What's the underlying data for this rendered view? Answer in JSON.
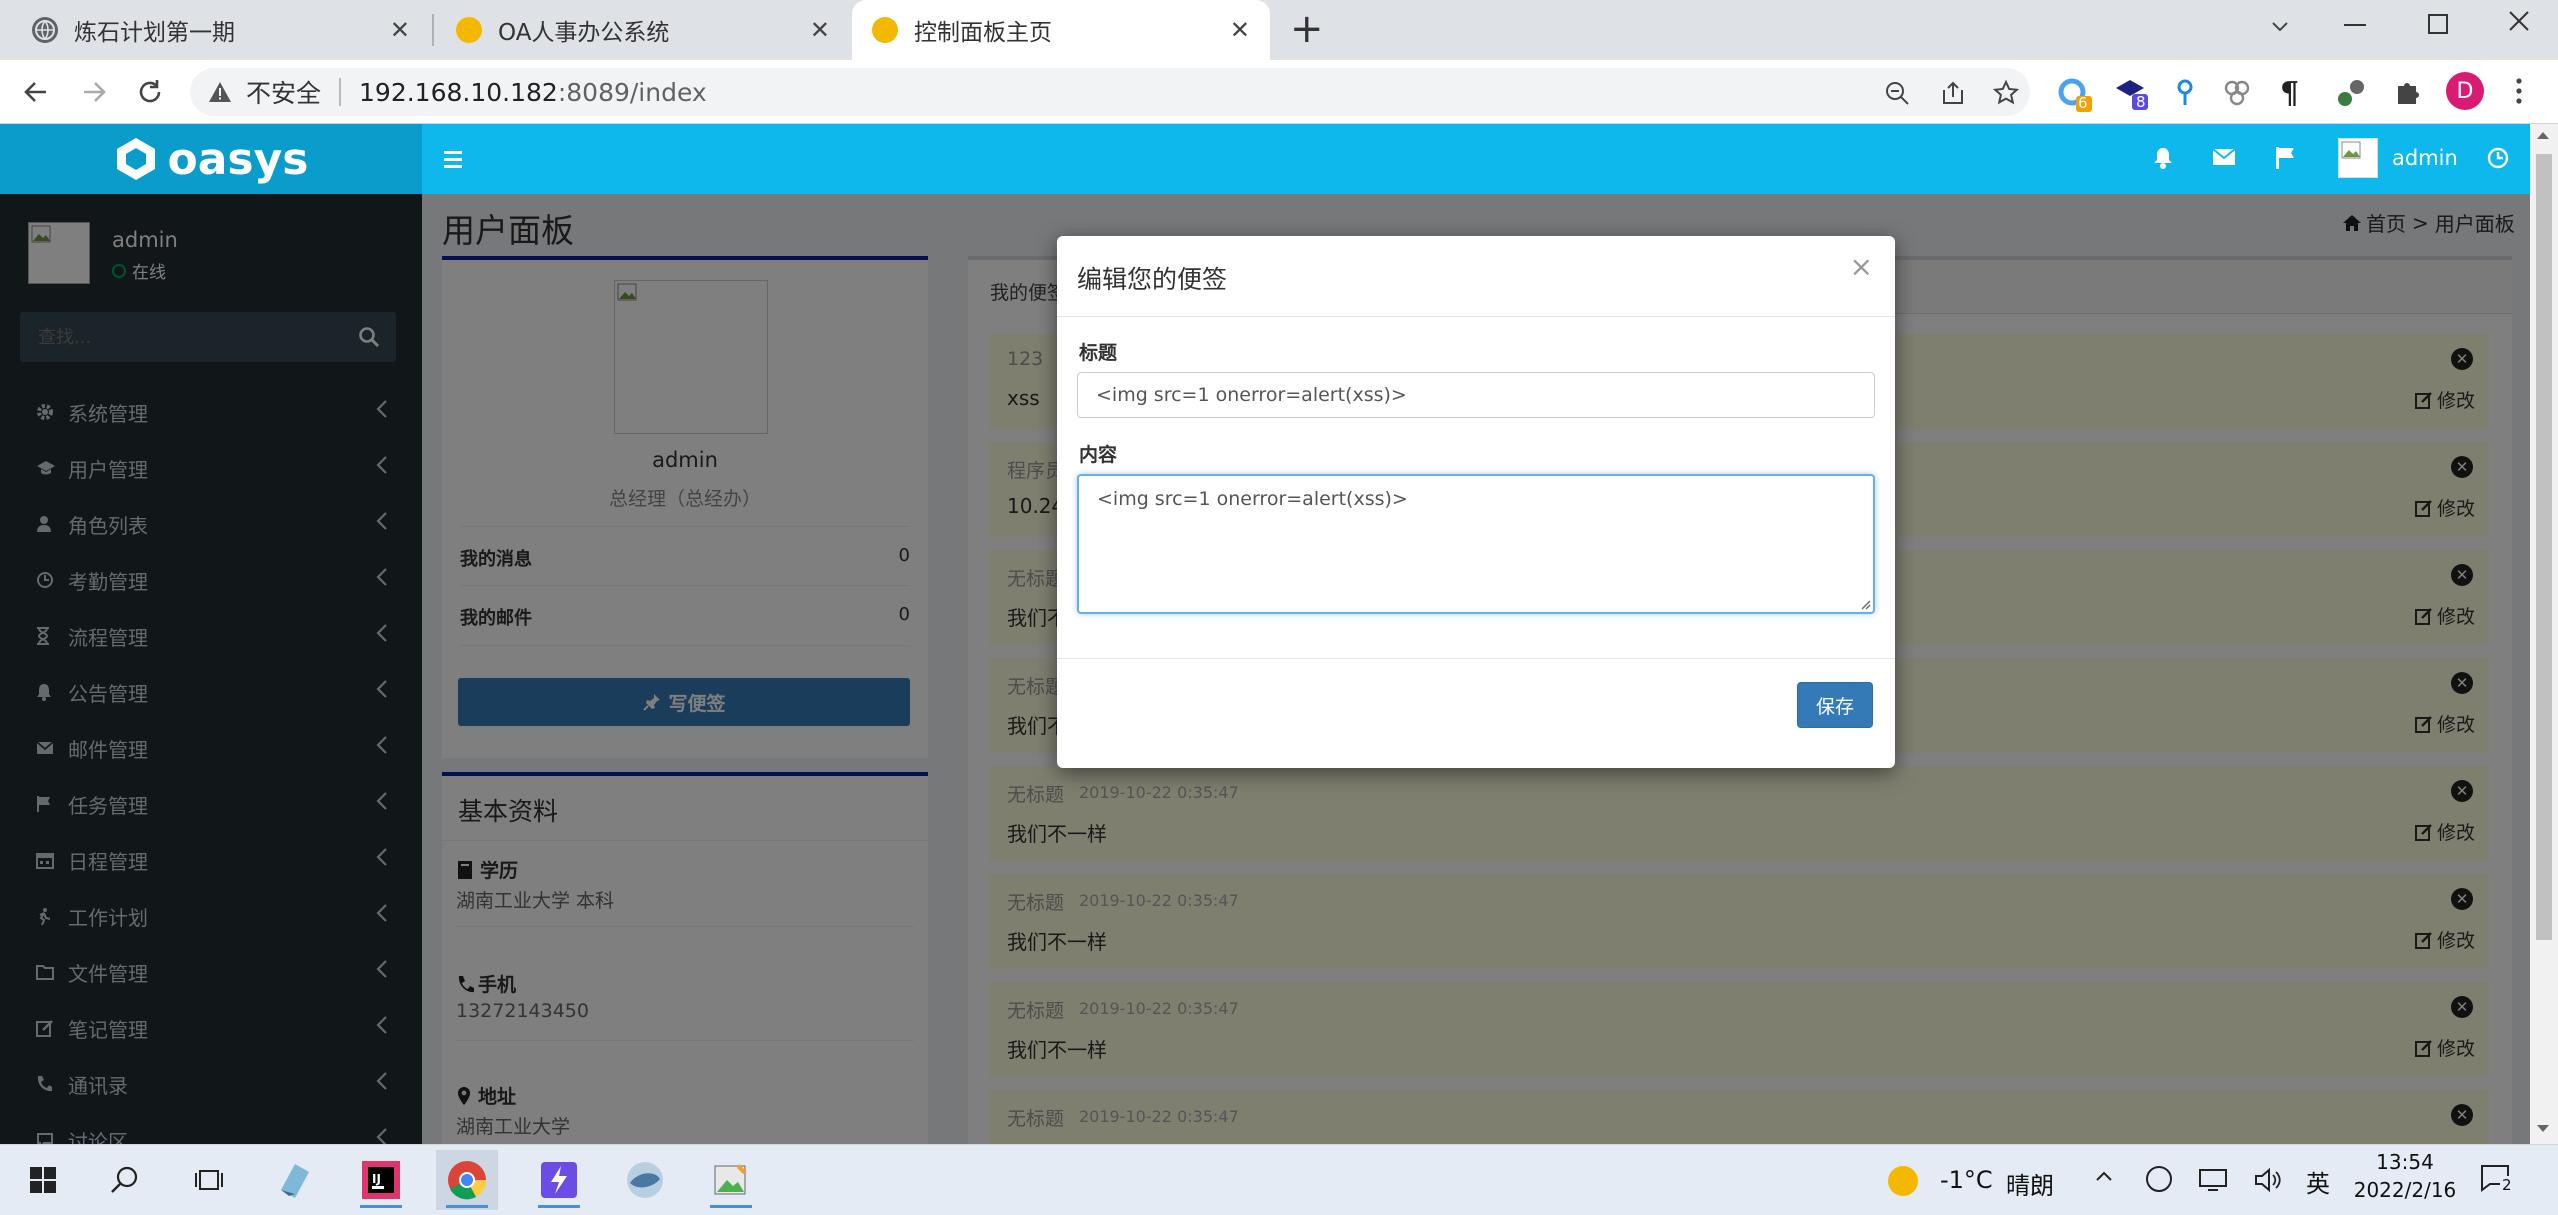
{
  "browser": {
    "tabs": [
      {
        "title": "炼石计划第一期",
        "close": "✕"
      },
      {
        "title": "OA人事办公系统",
        "close": "✕"
      },
      {
        "title": "控制面板主页",
        "close": "✕"
      }
    ],
    "new_tab": "+",
    "security_label": "不安全",
    "url_host": "192.168.10.182",
    "url_rest": ":8089/index",
    "extension_badges": [
      "6",
      "8"
    ],
    "profile_initial": "D"
  },
  "app": {
    "logo_text": "oasys",
    "header_user": "admin",
    "sidebar": {
      "user_name": "admin",
      "status": "在线",
      "search_placeholder": "查找...",
      "items": [
        {
          "label": "系统管理",
          "icon": "gear-icon"
        },
        {
          "label": "用户管理",
          "icon": "graduation-cap-icon"
        },
        {
          "label": "角色列表",
          "icon": "user-icon"
        },
        {
          "label": "考勤管理",
          "icon": "clock-icon"
        },
        {
          "label": "流程管理",
          "icon": "hourglass-icon"
        },
        {
          "label": "公告管理",
          "icon": "bell-icon"
        },
        {
          "label": "邮件管理",
          "icon": "envelope-icon"
        },
        {
          "label": "任务管理",
          "icon": "flag-icon"
        },
        {
          "label": "日程管理",
          "icon": "calendar-icon"
        },
        {
          "label": "工作计划",
          "icon": "walk-icon"
        },
        {
          "label": "文件管理",
          "icon": "folder-icon"
        },
        {
          "label": "笔记管理",
          "icon": "edit-icon"
        },
        {
          "label": "通讯录",
          "icon": "phone-icon"
        },
        {
          "label": "讨论区",
          "icon": "comment-icon"
        }
      ]
    },
    "page_title": "用户面板",
    "breadcrumb": {
      "home": "首页",
      "sep": ">",
      "current": "用户面板"
    },
    "profile": {
      "name": "admin",
      "role": "总经理（总经办）",
      "messages_label": "我的消息",
      "messages_count": "0",
      "mail_label": "我的邮件",
      "mail_count": "0",
      "write_note_button": "写便签"
    },
    "basic_info": {
      "title": "基本资料",
      "education_label": "学历",
      "education_value": "湖南工业大学 本科",
      "phone_label": "手机",
      "phone_value": "13272143450",
      "address_label": "地址",
      "address_value": "湖南工业大学"
    },
    "notes_tab": "我的便签",
    "notes": [
      {
        "title": "123",
        "date": "",
        "body": "xss",
        "edit": "修改"
      },
      {
        "title": "程序员",
        "date": "",
        "body": "10.24",
        "edit": "修改"
      },
      {
        "title": "无标题",
        "date": "",
        "body": "我们不一样",
        "edit": "修改"
      },
      {
        "title": "无标题",
        "date": "",
        "body": "我们不一样",
        "edit": "修改"
      },
      {
        "title": "无标题",
        "date": "2019-10-22 0:35:47",
        "body": "我们不一样",
        "edit": "修改"
      },
      {
        "title": "无标题",
        "date": "2019-10-22 0:35:47",
        "body": "我们不一样",
        "edit": "修改"
      },
      {
        "title": "无标题",
        "date": "2019-10-22 0:35:47",
        "body": "我们不一样",
        "edit": "修改"
      },
      {
        "title": "无标题",
        "date": "2019-10-22 0:35:47",
        "body": "",
        "edit": ""
      }
    ]
  },
  "modal": {
    "title": "编辑您的便签",
    "close": "×",
    "title_label": "标题",
    "title_value": "<img src=1 onerror=alert(xss)>",
    "content_label": "内容",
    "content_value": "<img src=1 onerror=alert(xss)>",
    "save_button": "保存"
  },
  "taskbar": {
    "weather_temp": "-1°C",
    "weather_desc": "晴朗",
    "ime": "英",
    "time": "13:54",
    "date": "2022/2/16",
    "notification_count": "2"
  },
  "colors": {
    "header": "#0fb8ec",
    "logo_bg": "#0a9dcc",
    "sidebar": "#222d32",
    "content_bg": "#ecf0f5",
    "box_border": "#0b1fa8",
    "note_bg": "#ffffe0",
    "primary_button": "#337ab7",
    "online": "#00a65a"
  }
}
